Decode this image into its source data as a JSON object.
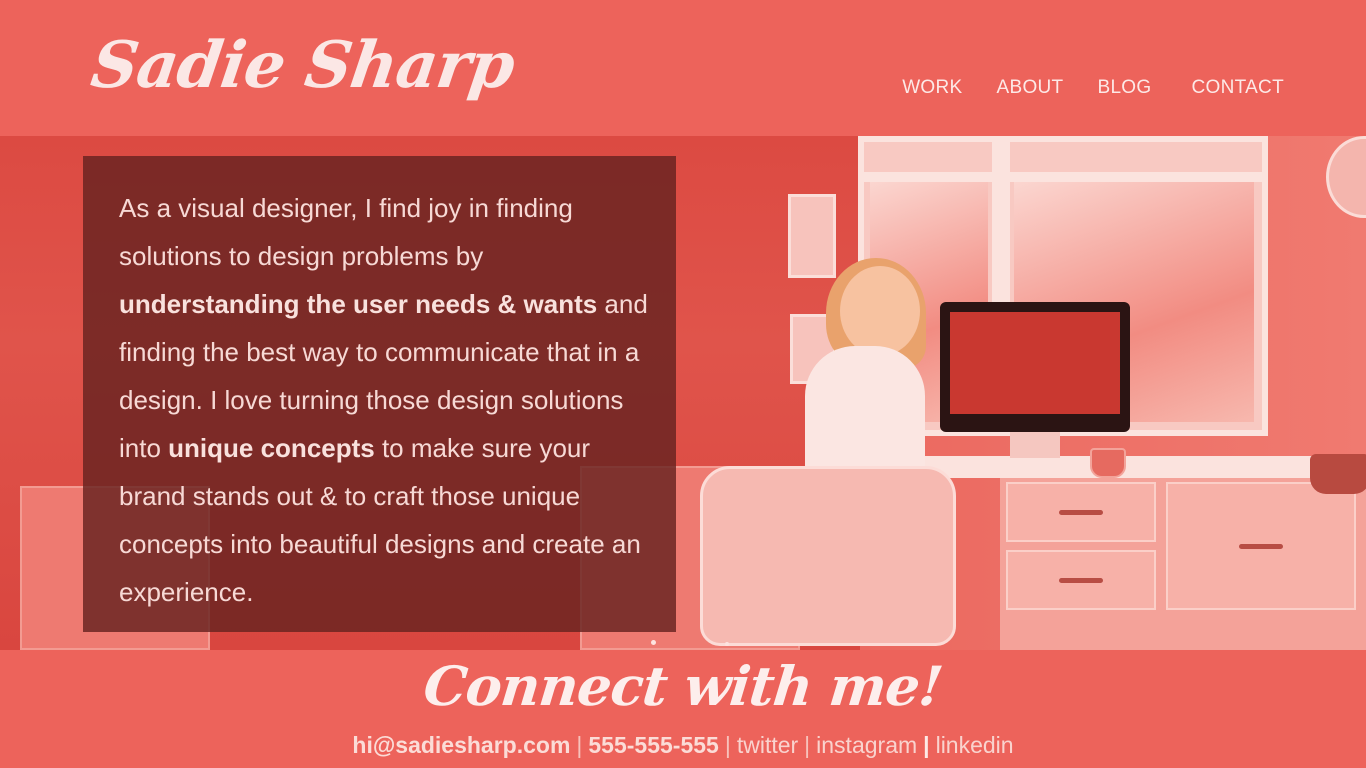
{
  "site": {
    "logo": "Sadie Sharp"
  },
  "nav": {
    "items": [
      {
        "label": "WORK"
      },
      {
        "label": "ABOUT"
      },
      {
        "label": "BLOG"
      },
      {
        "label": "CONTACT"
      }
    ]
  },
  "hero": {
    "intro_part1": "As a visual designer, I find joy in finding solutions to design problems by ",
    "intro_bold1": "understanding the user needs & wants",
    "intro_part2": " and finding the best way to communicate that in a design. I love turning those design solutions into ",
    "intro_bold2": "unique concepts",
    "intro_part3": " to make sure your brand stands out & to craft those unique concepts into beautiful designs and create an experience."
  },
  "footer": {
    "title": "Connect with me!",
    "email": "hi@sadiesharp.com",
    "phone": "555-555-555",
    "twitter": "twitter",
    "instagram": "instagram",
    "linkedin": "linkedin",
    "separator": "|"
  },
  "colors": {
    "brand": "#ed635b",
    "overlay": "#662220"
  }
}
